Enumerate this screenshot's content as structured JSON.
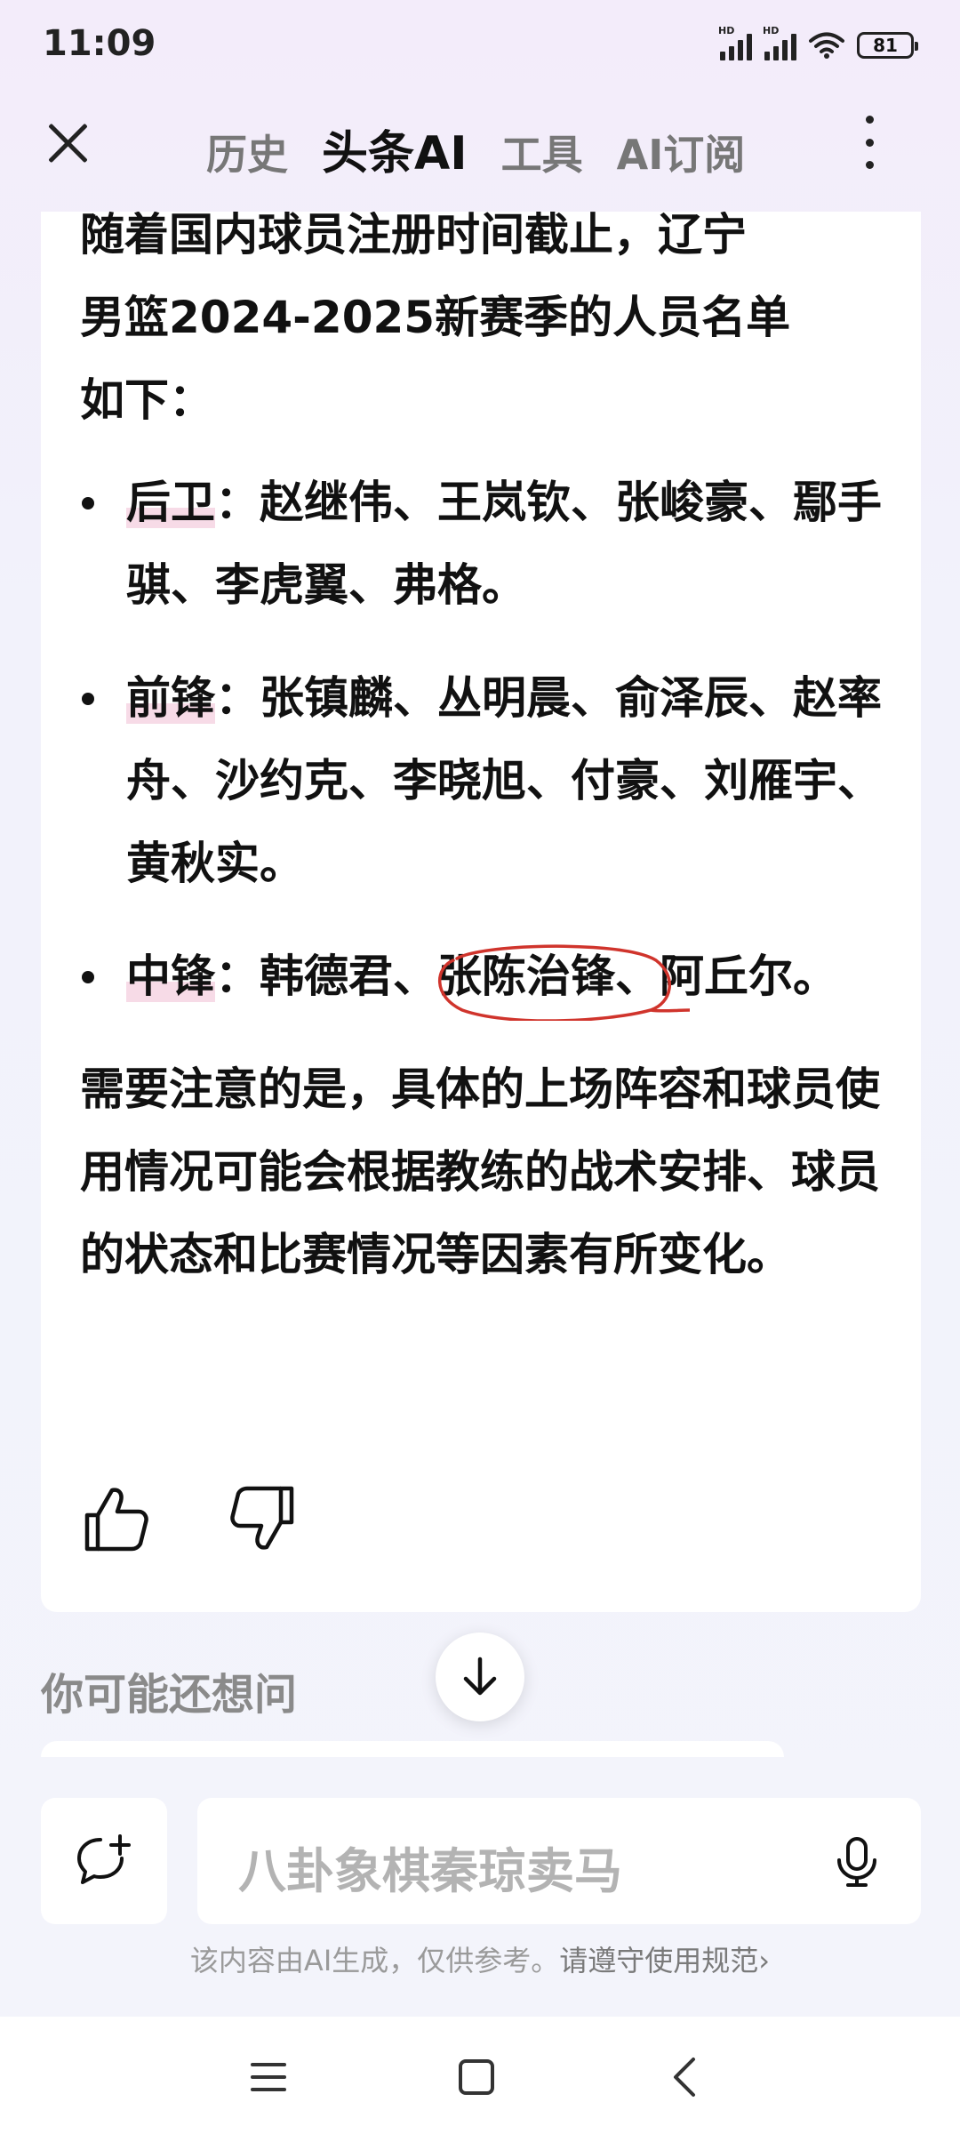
{
  "status_bar": {
    "time": "11:09",
    "battery": "81",
    "hd1": "HD",
    "hd2": "HD"
  },
  "nav": {
    "tabs": [
      {
        "label": "历史"
      },
      {
        "label": "头条AI"
      },
      {
        "label": "工具"
      },
      {
        "label": "AI订阅"
      }
    ]
  },
  "article": {
    "intro_line1": "随着国内球员注册时间截止，辽宁",
    "intro_line2": "男篮2024-2025新赛季的人员名单",
    "intro_line3": "如下：",
    "guards": {
      "role": "后卫",
      "sep": "：",
      "names": "赵继伟、王岚钦、张峻豪、鄢手骐、李虎翼、弗格。"
    },
    "forwards": {
      "role": "前锋",
      "sep": "：",
      "names": "张镇麟、丛明晨、俞泽辰、赵率舟、沙约克、李晓旭、付豪、刘雁宇、黄秋实。"
    },
    "centers": {
      "role": "中锋",
      "sep": "：",
      "names_before": "韩德君、",
      "names_circled": "张陈治锋、",
      "names_after": "阿丘尔。"
    },
    "note": "需要注意的是，具体的上场阵容和球员使用情况可能会根据教练的战术安排、球员的状态和比赛情况等因素有所变化。"
  },
  "suggestions": {
    "title": "你可能还想问"
  },
  "input": {
    "placeholder": "八卦象棋秦琼卖马"
  },
  "disclaimer": {
    "text": "该内容由AI生成，仅供参考。",
    "link": "请遵守使用规范",
    "chevron": "›"
  },
  "colors": {
    "accent_underline": "#f7dbe7",
    "circle_mark": "#d0342c"
  }
}
